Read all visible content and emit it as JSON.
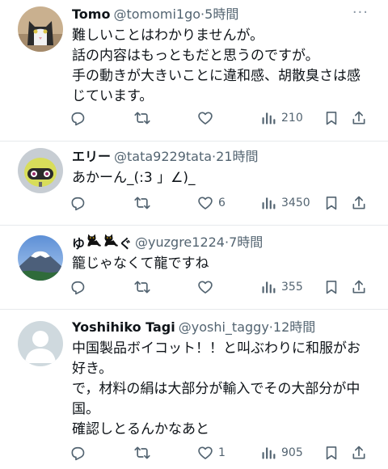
{
  "tweets": [
    {
      "name": "Tomo",
      "handle": "@tomomi1go",
      "sep": "·",
      "time": "5時間",
      "lines": [
        "難しいことはわかりませんが。",
        "話の内容はもっともだと思うのですが。",
        "手の動きが大きいことに違和感、胡散臭さは感",
        "じています。"
      ],
      "likes": "",
      "views": "210",
      "avatar": "cat-avatar"
    },
    {
      "name": "エリー",
      "handle": "@tata9229tata",
      "sep": "·",
      "time": "21時間",
      "lines": [
        "あかーん_(:3 」∠)_"
      ],
      "likes": "6",
      "views": "3450",
      "avatar": "robot-avatar"
    },
    {
      "name_prefix": "ゆ",
      "name_suffix": "ぐ",
      "handle": "@yuzgre1224",
      "sep": "·",
      "time": "7時間",
      "lines": [
        "籠じゃなくて龍ですね"
      ],
      "likes": "",
      "views": "355",
      "avatar": "mountain-avatar"
    },
    {
      "name": "Yoshihiko Tagi",
      "handle": "@yoshi_taggy",
      "sep": "·",
      "time": "12時間",
      "lines": [
        "中国製品ボイコット！！と叫ぶわりに和服がお",
        "好き。",
        "で，材料の絹は大部分が輸入でその大部分が中",
        "国。",
        "確認しとるんかなあと"
      ],
      "likes": "1",
      "views": "905",
      "avatar": "default-avatar"
    }
  ],
  "more_label": "···",
  "colors": {
    "text": "#0f1419",
    "muted": "#536471",
    "divider": "#e6e9ec"
  }
}
